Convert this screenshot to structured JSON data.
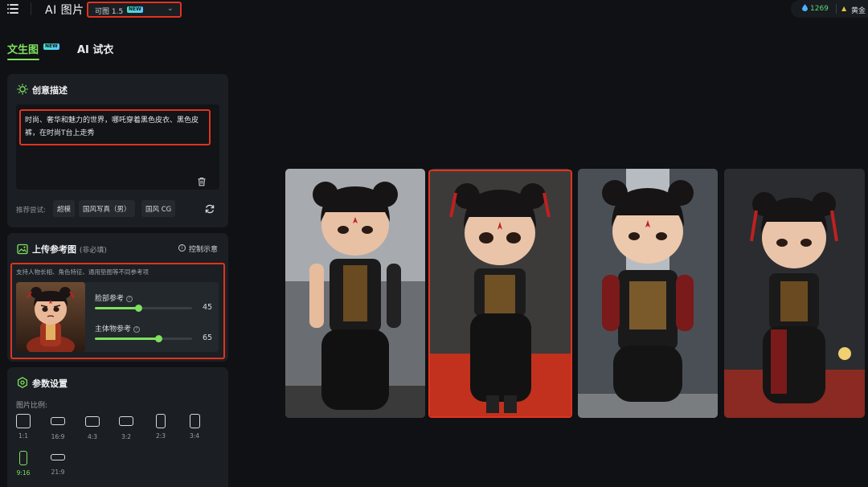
{
  "header": {
    "title": "AI 图片",
    "model": {
      "label": "可图 1.5",
      "badge": "NEW"
    },
    "credits": {
      "balance": "1269",
      "tier": "黄金"
    }
  },
  "tabs": [
    {
      "label": "文生图",
      "badge": "NEW",
      "active": true
    },
    {
      "label": "AI 试衣",
      "active": false
    }
  ],
  "prompt_panel": {
    "title": "创意描述",
    "text": "时尚、奢华和魅力的世界，哪吒穿着黑色皮衣、黑色皮裤，在时尚T台上走秀",
    "suggest_label": "推荐尝试:",
    "suggestions": [
      "超模",
      "国风写真（男）",
      "国风 CG"
    ]
  },
  "reference_panel": {
    "title": "上传参考图",
    "subtitle": "(非必填)",
    "control_link": "控制示意",
    "description": "支持人物长相、角色特征、通用垫图等不同参考项",
    "sliders": [
      {
        "label": "脸部参考",
        "value": 45
      },
      {
        "label": "主体物参考",
        "value": 65
      }
    ]
  },
  "params_panel": {
    "title": "参数设置",
    "ratio_label": "图片比例:",
    "ratios": [
      {
        "label": "1:1",
        "active": false
      },
      {
        "label": "16:9",
        "active": false
      },
      {
        "label": "4:3",
        "active": false
      },
      {
        "label": "3:2",
        "active": false
      },
      {
        "label": "2:3",
        "active": false
      },
      {
        "label": "3:4",
        "active": false
      },
      {
        "label": "9:16",
        "active": true
      },
      {
        "label": "21:9",
        "active": false
      }
    ]
  },
  "gallery": {
    "count": 4,
    "selected_index": 1
  },
  "colors": {
    "accent": "#7fe05e",
    "highlight": "#e1331f",
    "background": "#0f1114",
    "panel": "#1b1f23"
  },
  "icons": [
    "menu-icon",
    "chevron-down-icon",
    "drop-icon",
    "crown-icon",
    "lightbulb-icon",
    "trash-icon",
    "refresh-icon",
    "image-icon",
    "info-icon",
    "help-icon",
    "settings-hex-icon"
  ]
}
